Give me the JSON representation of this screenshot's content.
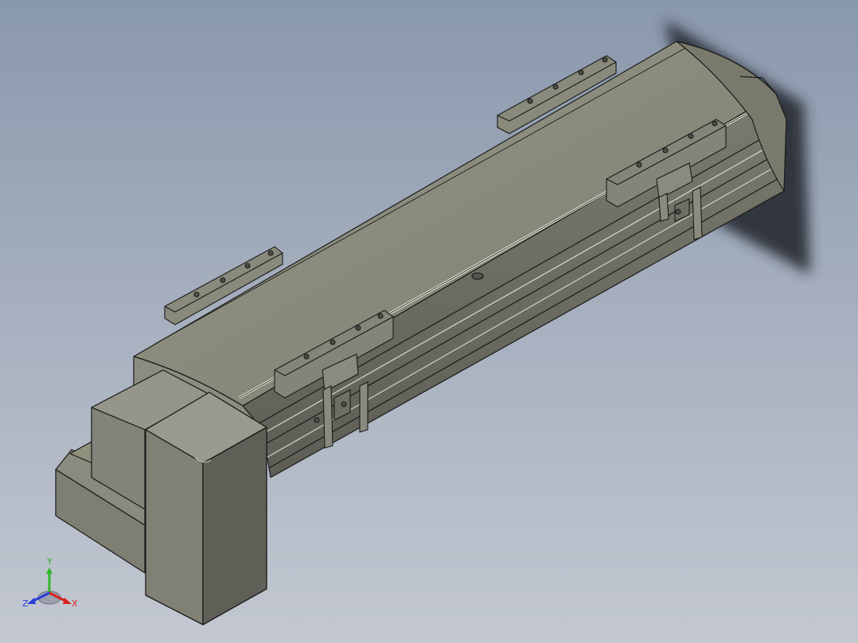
{
  "viewport": {
    "model": "linear-actuator-with-motor",
    "colors": {
      "background_top": "#8a98ad",
      "background_bottom": "#c3c8d1",
      "body_top": "#8d8d80",
      "body_side": "#74746a",
      "body_dark": "#5a5a52",
      "edge": "#1a1a1a",
      "shadow": "#2a2e36"
    }
  },
  "triad": {
    "x_label": "X",
    "y_label": "Y",
    "z_label": "Z",
    "x_color": "#d8231e",
    "y_color": "#2fb52c",
    "z_color": "#2a3fd8"
  }
}
